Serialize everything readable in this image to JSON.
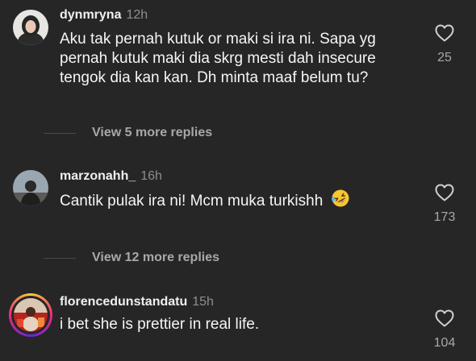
{
  "comments": [
    {
      "username": "dynmryna",
      "time": "12h",
      "text": "Aku tak pernah kutuk or maki si ira ni. Sapa yg pernah kutuk maki dia skrg mesti dah insecure tengok dia kan kan. Dh minta maaf belum tu?",
      "likes": "25",
      "replies_label": "View 5 more replies"
    },
    {
      "username": "marzonahh_",
      "time": "16h",
      "text": "Cantik pulak ira ni! Mcm muka turkishh",
      "emoji": "rolling-on-floor-laughing-emoji",
      "likes": "173",
      "replies_label": "View 12 more replies"
    },
    {
      "username": "florencedunstandatu",
      "time": "15h",
      "text": "i bet she is prettier in real life.",
      "likes": "104",
      "story_ring": true
    }
  ],
  "icons": {
    "like": "heart-outline-icon"
  },
  "colors": {
    "background": "#262626",
    "secondary_text": "#a8a8a8"
  }
}
